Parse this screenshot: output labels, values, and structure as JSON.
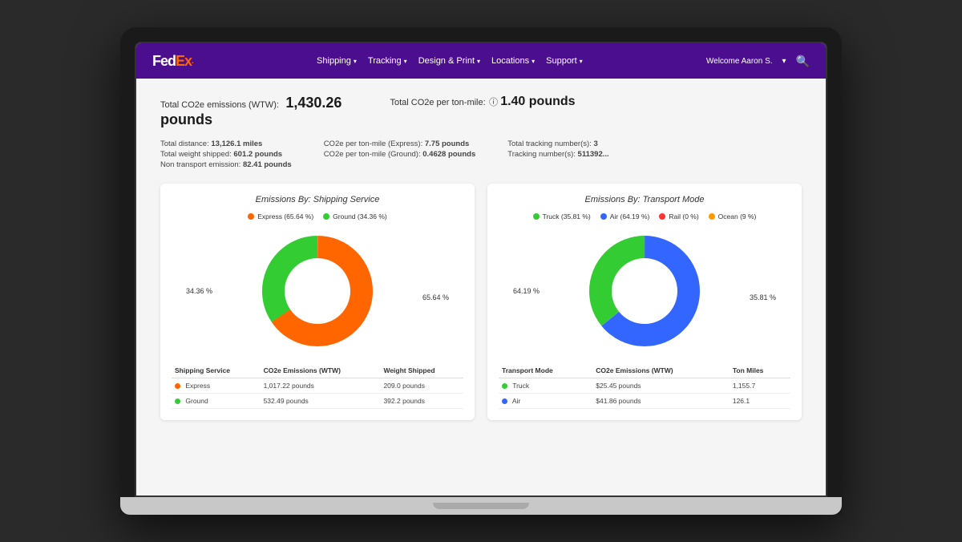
{
  "navbar": {
    "logo_fed": "Fed",
    "logo_ex": "Ex",
    "logo_dot": ".",
    "links": [
      {
        "label": "Shipping",
        "id": "shipping"
      },
      {
        "label": "Tracking",
        "id": "tracking"
      },
      {
        "label": "Design & Print",
        "id": "design"
      },
      {
        "label": "Locations",
        "id": "locations"
      },
      {
        "label": "Support",
        "id": "support"
      }
    ],
    "user_label": "Welcome Aaron S.",
    "search_icon": "🔍"
  },
  "hero": {
    "co2e_label": "Total CO2e emissions (WTW):",
    "co2e_value": "1,430.26",
    "co2e_unit": "pounds",
    "per_ton_label": "Total CO2e per ton-mile:",
    "per_ton_value": "1.40 pounds"
  },
  "details": {
    "distance_label": "Total distance:",
    "distance_value": "13,126.1 miles",
    "weight_label": "Total weight shipped:",
    "weight_value": "601.2 pounds",
    "non_transport_label": "Non transport emission:",
    "non_transport_value": "82.41 pounds",
    "express_ton_label": "CO2e per ton-mile (Express):",
    "express_ton_value": "7.75 pounds",
    "ground_ton_label": "CO2e per ton-mile (Ground):",
    "ground_ton_value": "0.4628 pounds",
    "tracking_count_label": "Total tracking number(s):",
    "tracking_count_value": "3",
    "tracking_numbers_label": "Tracking number(s):",
    "tracking_numbers_value": "511392..."
  },
  "chart1": {
    "title": "Emissions By: Shipping Service",
    "legend": [
      {
        "label": "Express (65.64 %)",
        "color": "#ff6600"
      },
      {
        "label": "Ground (34.36 %)",
        "color": "#33cc33"
      }
    ],
    "label_left": "34.36 %",
    "label_right": "65.64 %",
    "segments": [
      {
        "value": 65.64,
        "color": "#ff6600"
      },
      {
        "value": 34.36,
        "color": "#33cc33"
      }
    ],
    "table_headers": [
      "Shipping Service",
      "CO2e Emissions (WTW)",
      "Weight Shipped"
    ],
    "table_rows": [
      {
        "name": "Express",
        "color": "#ff6600",
        "emissions": "1,017.22 pounds",
        "weight": "209.0 pounds"
      },
      {
        "name": "Ground",
        "color": "#33cc33",
        "emissions": "532.49 pounds",
        "weight": "392.2 pounds"
      }
    ]
  },
  "chart2": {
    "title": "Emissions By: Transport Mode",
    "legend": [
      {
        "label": "Truck (35.81 %)",
        "color": "#33cc33"
      },
      {
        "label": "Air (64.19 %)",
        "color": "#3366ff"
      },
      {
        "label": "Rail (0 %)",
        "color": "#ff3333"
      },
      {
        "label": "Ocean (9 %)",
        "color": "#ff9900"
      }
    ],
    "label_left": "64.19 %",
    "label_right": "35.81 %",
    "segments": [
      {
        "value": 64.19,
        "color": "#3366ff"
      },
      {
        "value": 35.81,
        "color": "#33cc33"
      }
    ],
    "table_headers": [
      "Transport Mode",
      "CO2e Emissions (WTW)",
      "Ton Miles"
    ],
    "table_rows": [
      {
        "name": "Truck",
        "color": "#33cc33",
        "emissions": "$25.45 pounds",
        "ton_miles": "1,155.7"
      },
      {
        "name": "Air",
        "color": "#3366ff",
        "emissions": "$41.86 pounds",
        "ton_miles": "126.1"
      }
    ]
  }
}
